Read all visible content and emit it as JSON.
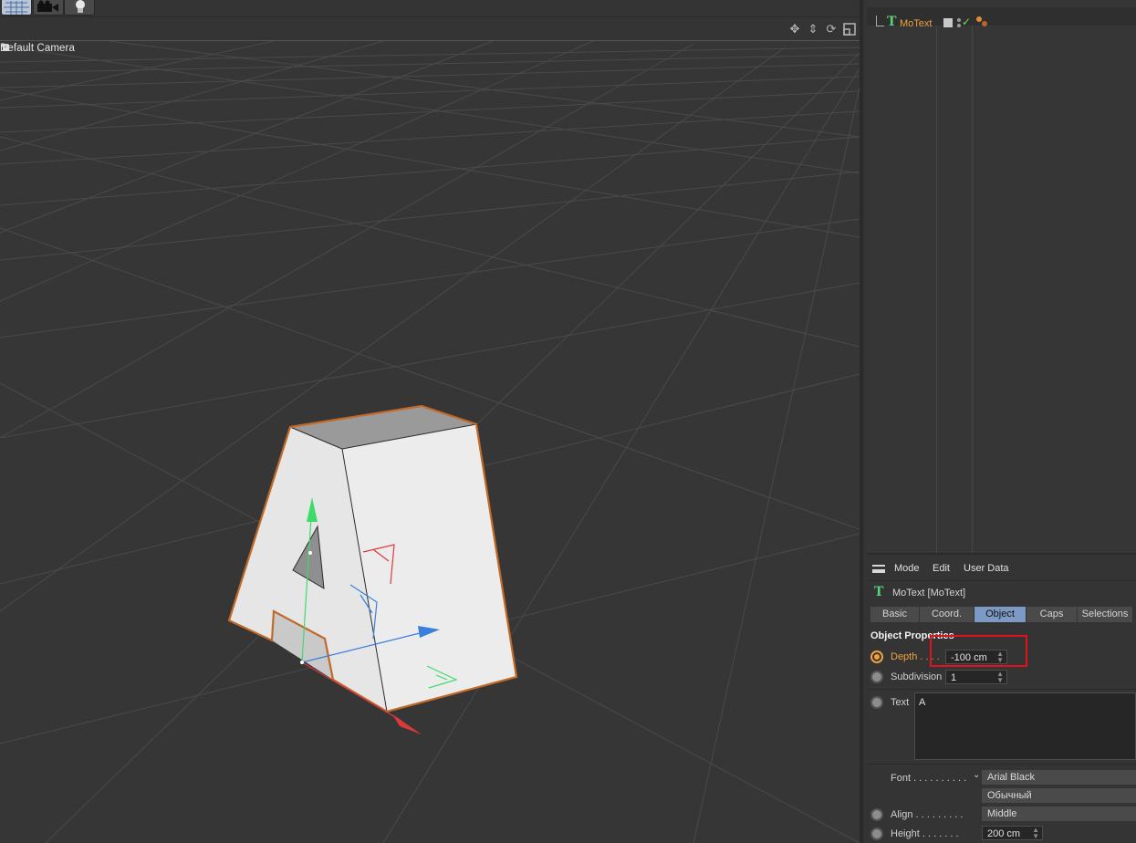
{
  "viewport": {
    "camera_label": "Default Camera",
    "nav_icons": [
      "move-icon",
      "zoom-icon",
      "rotate-icon",
      "maximize-icon"
    ]
  },
  "object_manager": {
    "object_name": "MoText"
  },
  "attribute_manager": {
    "menu": [
      "Mode",
      "Edit",
      "User Data"
    ],
    "object_title": "MoText [MoText]",
    "tabs": [
      "Basic",
      "Coord.",
      "Object",
      "Caps",
      "Selections"
    ],
    "active_tab": "Object",
    "section_title": "Object Properties",
    "depth": {
      "label": "Depth . . . .",
      "value": "-100 cm"
    },
    "subdivision": {
      "label": "Subdivision",
      "value": "1"
    },
    "text": {
      "label": "Text",
      "value": "A"
    },
    "font": {
      "label": "Font . . . . . . . . . .",
      "family": "Arial Black",
      "style": "Обычный"
    },
    "align": {
      "label": "Align . . . . . . . . .",
      "value": "Middle"
    },
    "height": {
      "label": "Height . . . . . . .",
      "value": "200 cm"
    }
  },
  "colors": {
    "accent_orange": "#f0a33a",
    "active_tab": "#7d9ac4",
    "highlight_box": "#e0121a",
    "motext_icon": "#5ad07a"
  }
}
